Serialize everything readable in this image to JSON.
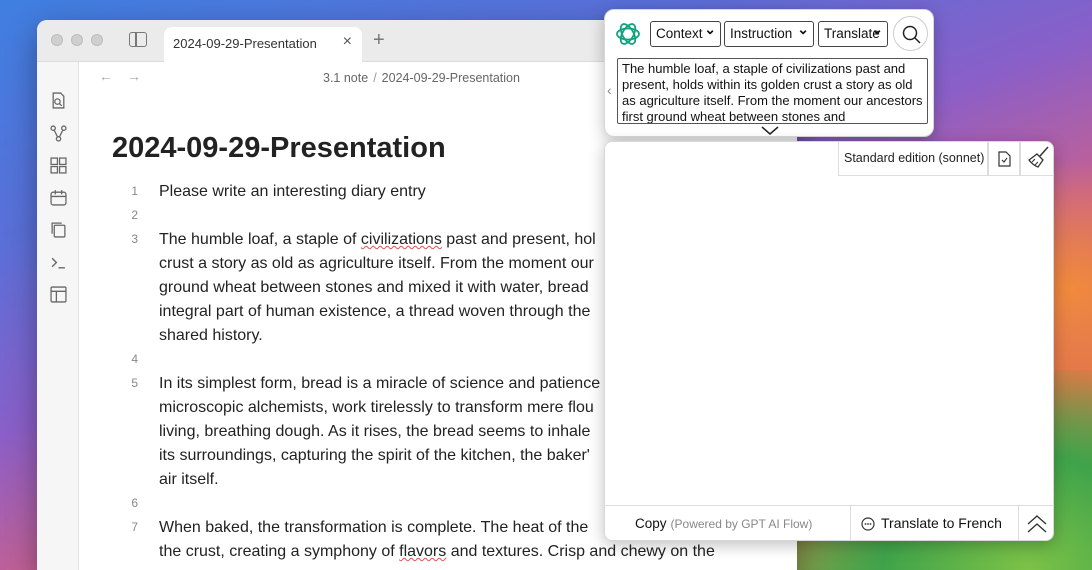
{
  "editor": {
    "tab_title": "2024-09-29-Presentation",
    "breadcrumb": [
      "3.1 note",
      "2024-09-29-Presentation"
    ],
    "doc_title": "2024-09-29-Presentation",
    "lines": [
      {
        "num": "1",
        "text": [
          "Please write an interesting diary entry"
        ]
      },
      {
        "num": "2",
        "text": []
      },
      {
        "num": "3",
        "text": [
          "The humble loaf, a staple of civilizations past and present, hol",
          "crust a story as old as agriculture itself. From the moment our",
          "ground wheat between stones and mixed it with water, bread",
          "integral part of human existence, a thread woven through the",
          "shared history."
        ]
      },
      {
        "num": "4",
        "text": []
      },
      {
        "num": "5",
        "text": [
          "In its simplest form, bread is a miracle of science and patience",
          "microscopic alchemists, work tirelessly to transform mere flou",
          "living, breathing dough. As it rises, the bread seems to inhale",
          "its surroundings, capturing the spirit of the kitchen, the baker'",
          "air itself."
        ]
      },
      {
        "num": "6",
        "text": []
      },
      {
        "num": "7",
        "text": [
          "When baked, the transformation is complete. The heat of the",
          "the crust, creating a symphony of flavors and textures. Crisp and chewy on the"
        ]
      }
    ]
  },
  "popup": {
    "selects": {
      "context": "Context",
      "instruction": "Instruction",
      "translate": "Translate"
    },
    "selected_text": "The humble loaf, a staple of civilizations past and present, holds within its golden crust a story as old as agriculture itself. From the moment our ancestors first ground wheat between stones and",
    "model_label": "Standard edition (sonnet)",
    "copy_label": "Copy",
    "powered_label": "(Powered by GPT AI Flow)",
    "translate_label": "Translate to French"
  },
  "icons": [
    "sidebar-toggle-icon",
    "close-icon",
    "plus-icon",
    "back-arrow-icon",
    "forward-arrow-icon",
    "search-icon",
    "chatgpt-logo-icon",
    "document-icon",
    "broom-icon",
    "chat-bubble-icon",
    "double-chevron-up-icon"
  ]
}
